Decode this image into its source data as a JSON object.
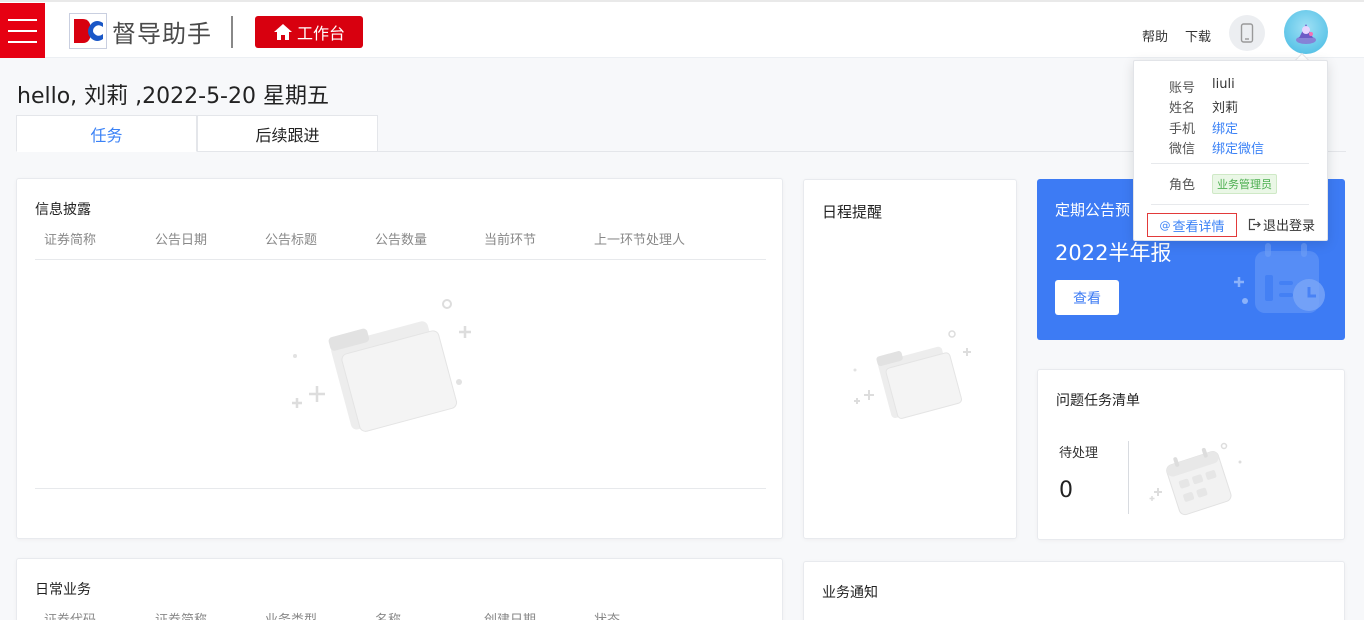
{
  "header": {
    "brand": "督导助手",
    "workbench_label": "工作台",
    "help_label": "帮助",
    "download_label": "下载"
  },
  "greeting": "hello, 刘莉 ,2022-5-20 星期五",
  "tabs": [
    {
      "label": "任务",
      "active": true
    },
    {
      "label": "后续跟进",
      "active": false
    }
  ],
  "info_disclosure": {
    "title": "信息披露",
    "columns": [
      "证券简称",
      "公告日期",
      "公告标题",
      "公告数量",
      "当前环节",
      "上一环节处理人"
    ]
  },
  "schedule": {
    "title": "日程提醒"
  },
  "announcement": {
    "title": "定期公告预",
    "big_text": "2022半年报",
    "button_label": "查看"
  },
  "issues": {
    "title": "问题任务清单",
    "pending_label": "待处理",
    "pending_count": "0"
  },
  "daily": {
    "title": "日常业务",
    "columns": [
      "证券代码",
      "证券简称",
      "业务类型",
      "名称",
      "创建日期",
      "状态"
    ]
  },
  "notice": {
    "title": "业务通知"
  },
  "user_popup": {
    "account_label": "账号",
    "account_value": "liuli",
    "name_label": "姓名",
    "name_value": "刘莉",
    "phone_label": "手机",
    "phone_link": "绑定",
    "wechat_label": "微信",
    "wechat_link": "绑定微信",
    "role_label": "角色",
    "role_value": "业务管理员",
    "detail_label": "查看详情",
    "logout_label": "退出登录"
  },
  "colors": {
    "brand_red": "#d8000f",
    "accent_blue": "#3d7bf4",
    "link_blue": "#3b82f6",
    "role_green": "#4caf50"
  }
}
